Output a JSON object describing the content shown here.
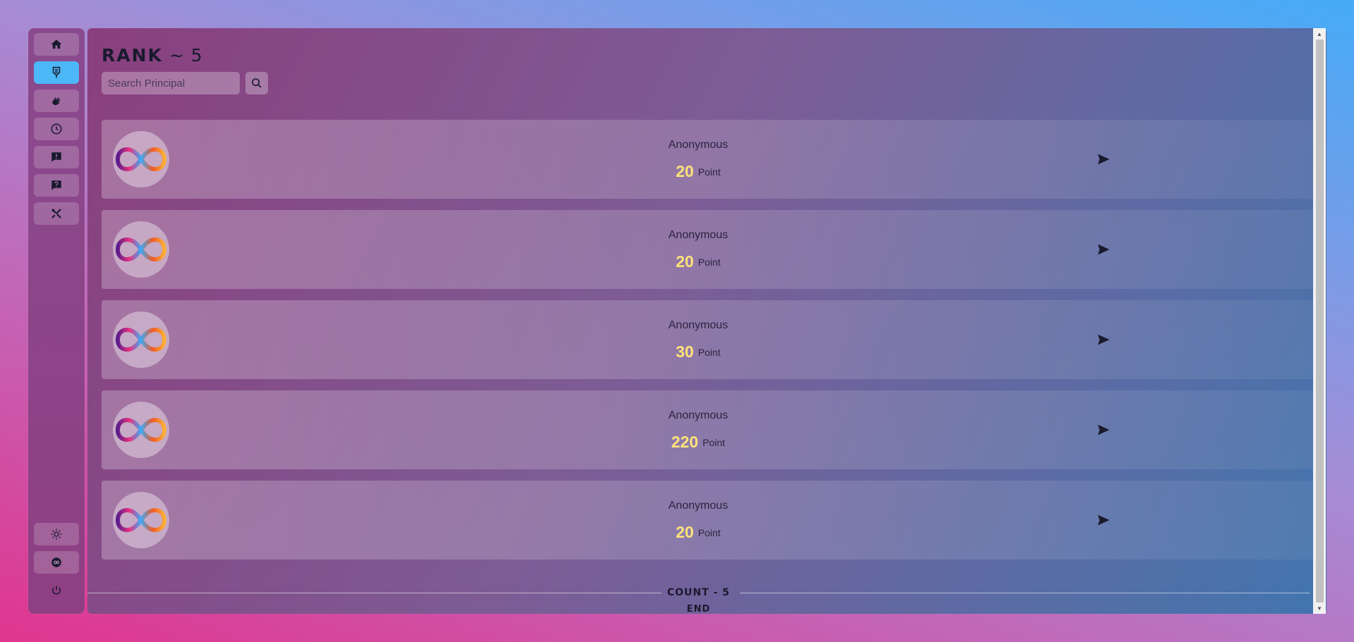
{
  "sidebar": {
    "items": [
      {
        "icon": "home-icon",
        "label": "Home",
        "active": false
      },
      {
        "icon": "shield-medal-icon",
        "label": "Rank",
        "active": true
      },
      {
        "icon": "hand-icon",
        "label": "Hands",
        "active": false
      },
      {
        "icon": "clock-icon",
        "label": "History",
        "active": false
      },
      {
        "icon": "alert-message-icon",
        "label": "Report",
        "active": false
      },
      {
        "icon": "help-message-icon",
        "label": "Help",
        "active": false
      },
      {
        "icon": "tools-icon",
        "label": "Settings",
        "active": false
      }
    ],
    "bottom_items": [
      {
        "icon": "sun-icon",
        "label": "Theme"
      },
      {
        "icon": "infinity-icon",
        "label": "Internet Identity"
      },
      {
        "icon": "power-icon",
        "label": "Logout"
      }
    ]
  },
  "header": {
    "rank_word": "RANK",
    "rank_sep": "~",
    "rank_count": "5"
  },
  "search": {
    "placeholder": "Search Principal",
    "value": ""
  },
  "entries": [
    {
      "name": "Anonymous",
      "points": "20",
      "unit": "Point"
    },
    {
      "name": "Anonymous",
      "points": "20",
      "unit": "Point"
    },
    {
      "name": "Anonymous",
      "points": "30",
      "unit": "Point"
    },
    {
      "name": "Anonymous",
      "points": "220",
      "unit": "Point"
    },
    {
      "name": "Anonymous",
      "points": "20",
      "unit": "Point"
    }
  ],
  "footer": {
    "count_label": "COUNT - 5",
    "end_label": "END"
  },
  "colors": {
    "accent": "#4db8f7",
    "points": "#ffe27a"
  }
}
